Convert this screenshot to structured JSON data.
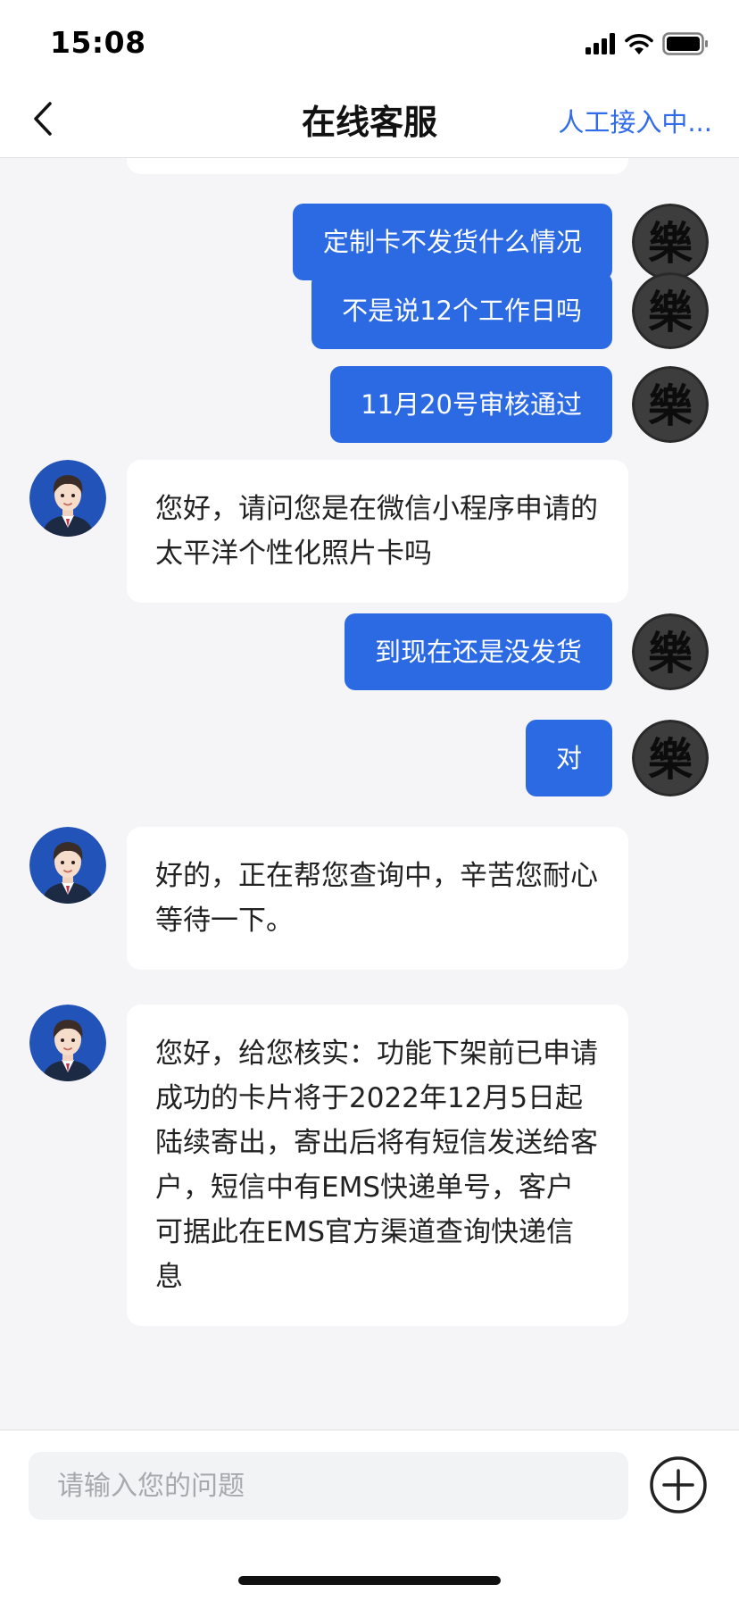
{
  "status_bar": {
    "time": "15:08",
    "icons": [
      "signal-icon",
      "wifi-icon",
      "battery-icon"
    ]
  },
  "nav": {
    "back_icon": "chevron-left-icon",
    "title": "在线客服",
    "status": "人工接入中..."
  },
  "messages": [
    {
      "from": "user",
      "text": "定制卡不发货什么情况"
    },
    {
      "from": "user",
      "text": "不是说12个工作日吗"
    },
    {
      "from": "user",
      "text": "11月20号审核通过"
    },
    {
      "from": "agent",
      "text": "您好，请问您是在微信小程序申请的太平洋个性化照片卡吗"
    },
    {
      "from": "user",
      "text": "到现在还是没发货"
    },
    {
      "from": "user",
      "text": "对"
    },
    {
      "from": "agent",
      "text": "好的，正在帮您查询中，辛苦您耐心等待一下。"
    },
    {
      "from": "agent",
      "text": "您好，给您核实：功能下架前已申请成功的卡片将于2022年12月5日起陆续寄出，寄出后将有短信发送给客户，短信中有EMS快递单号，客户可据此在EMS官方渠道查询快递信息"
    }
  ],
  "input": {
    "placeholder": "请输入您的问题",
    "value": "",
    "add_icon": "plus-circle-icon"
  },
  "colors": {
    "accent": "#2c6ae3",
    "link": "#2f6bea",
    "chat_background": "#f5f5f7",
    "bubble_in": "#ffffff"
  }
}
